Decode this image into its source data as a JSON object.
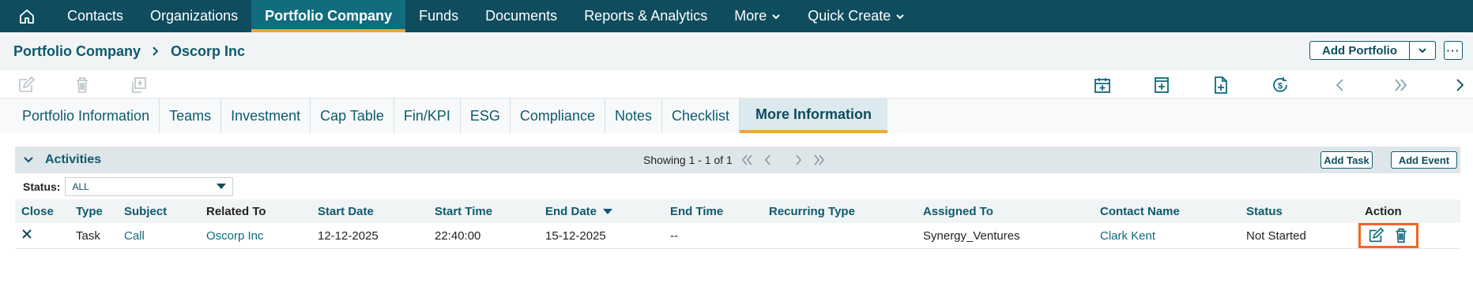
{
  "nav": {
    "items": [
      {
        "label": "Contacts",
        "active": false
      },
      {
        "label": "Organizations",
        "active": false
      },
      {
        "label": "Portfolio Company",
        "active": true
      },
      {
        "label": "Funds",
        "active": false
      },
      {
        "label": "Documents",
        "active": false
      },
      {
        "label": "Reports & Analytics",
        "active": false
      },
      {
        "label": "More",
        "active": false,
        "dropdown": true
      },
      {
        "label": "Quick Create",
        "active": false,
        "dropdown": true
      }
    ]
  },
  "breadcrumb": {
    "parent": "Portfolio Company",
    "current": "Oscorp Inc"
  },
  "header_buttons": {
    "add_portfolio": "Add Portfolio",
    "more": "···"
  },
  "tabs": [
    {
      "label": "Portfolio Information"
    },
    {
      "label": "Teams"
    },
    {
      "label": "Investment"
    },
    {
      "label": "Cap Table"
    },
    {
      "label": "Fin/KPI"
    },
    {
      "label": "ESG"
    },
    {
      "label": "Compliance"
    },
    {
      "label": "Notes"
    },
    {
      "label": "Checklist"
    },
    {
      "label": "More Information",
      "active": true
    }
  ],
  "activities": {
    "title": "Activities",
    "pager_text": "Showing 1 - 1 of 1",
    "add_task": "Add Task",
    "add_event": "Add Event",
    "status_label": "Status:",
    "status_value": "ALL",
    "columns": [
      "Close",
      "Type",
      "Subject",
      "Related To",
      "Start Date",
      "Start Time",
      "End Date",
      "End Time",
      "Recurring Type",
      "Assigned To",
      "Contact Name",
      "Status",
      "Action"
    ],
    "rows": [
      {
        "close": "✕",
        "type": "Task",
        "subject": "Call",
        "related_to": "Oscorp Inc",
        "start_date": "12-12-2025",
        "start_time": "22:40:00",
        "end_date": "15-12-2025",
        "end_time": "--",
        "recurring_type": "",
        "assigned_to": "Synergy_Ventures",
        "contact_name": "Clark Kent",
        "status": "Not Started"
      }
    ]
  },
  "colors": {
    "nav_bg": "#0e4c5e",
    "accent": "#f2a33a",
    "link": "#0e6a7c",
    "highlight": "#f26722"
  },
  "icons": [
    "home-icon",
    "edit-icon",
    "trash-icon",
    "copy-icon",
    "calendar-add-icon",
    "note-add-icon",
    "document-add-icon",
    "dollar-refresh-icon",
    "prev-icon",
    "double-next-icon",
    "next-icon"
  ]
}
